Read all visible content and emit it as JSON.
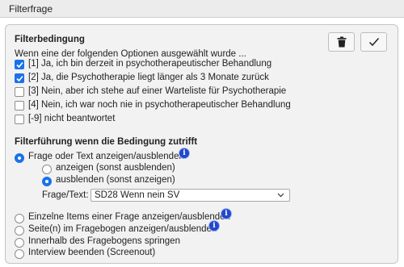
{
  "window": {
    "title": "Filterfrage"
  },
  "condition": {
    "heading": "Filterbedingung",
    "intro": "Wenn eine der folgenden Optionen ausgewählt wurde ...",
    "options": [
      {
        "label": "[1] Ja, ich bin derzeit in psychotherapeutischer Behandlung",
        "checked": true
      },
      {
        "label": "[2] Ja, die Psychotherapie liegt länger als 3 Monate zurück",
        "checked": true
      },
      {
        "label": "[3] Nein, aber ich stehe auf einer Warteliste für Psychotherapie",
        "checked": false
      },
      {
        "label": "[4] Nein, ich war noch nie in psychotherapeutischer Behandlung",
        "checked": false
      },
      {
        "label": "[-9] nicht beantwortet",
        "checked": false
      }
    ]
  },
  "toolbar": {
    "delete_icon": "trash-icon",
    "confirm_icon": "checkmark-icon"
  },
  "action": {
    "heading": "Filterführung wenn die Bedingung zutrifft",
    "show_hide_question": "Frage oder Text anzeigen/ausblenden",
    "suboption_show": "anzeigen (sonst ausblenden)",
    "suboption_hide": "ausblenden (sonst anzeigen)",
    "target_label": "Frage/Text:",
    "target_value": "SD28 Wenn nein SV",
    "items": "Einzelne Items einer Frage anzeigen/ausblenden",
    "pages": "Seite(n) im Fragebogen anzeigen/ausblenden",
    "jump": "Innerhalb des Fragebogens springen",
    "screenout": "Interview beenden (Screenout)",
    "info_icon": "info-icon",
    "accent_color": "#1a73e8"
  }
}
